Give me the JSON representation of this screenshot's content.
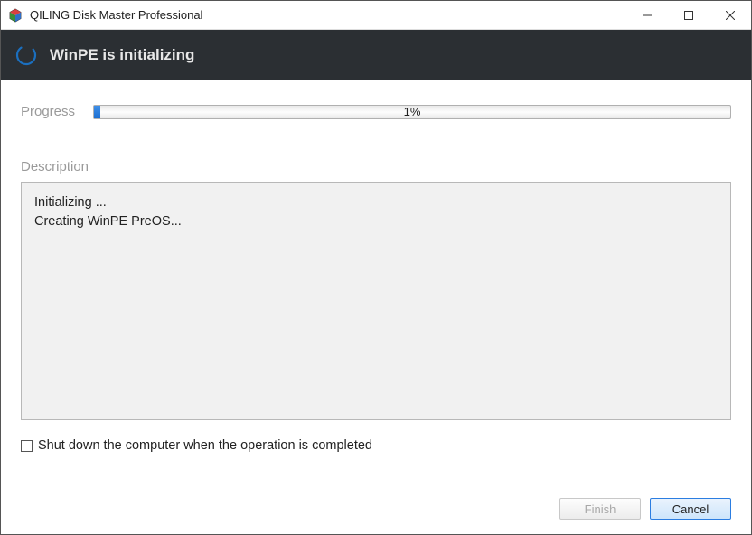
{
  "titlebar": {
    "title": "QILING Disk Master Professional"
  },
  "header": {
    "heading": "WinPE is initializing"
  },
  "progress": {
    "label": "Progress",
    "percent_text": "1%",
    "percent_value": 1
  },
  "description": {
    "label": "Description",
    "lines": [
      "Initializing ...",
      "Creating WinPE PreOS..."
    ]
  },
  "checkbox": {
    "label": "Shut down the computer when the operation is completed",
    "checked": false
  },
  "buttons": {
    "finish": "Finish",
    "cancel": "Cancel"
  }
}
